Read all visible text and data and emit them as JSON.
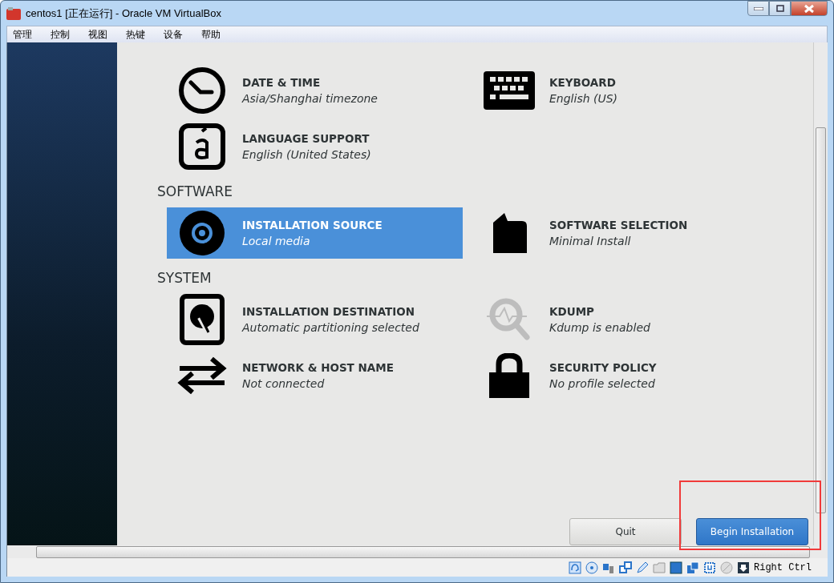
{
  "window": {
    "title": "centos1 [正在运行] - Oracle VM VirtualBox"
  },
  "menu": [
    "管理",
    "控制",
    "视图",
    "热键",
    "设备",
    "帮助"
  ],
  "sections": [
    {
      "items": [
        {
          "kind": "clock",
          "title": "DATE & TIME",
          "status": "Asia/Shanghai timezone",
          "selected": false,
          "disabled": false
        },
        {
          "kind": "keyboard",
          "title": "KEYBOARD",
          "status": "English (US)",
          "selected": false,
          "disabled": false
        },
        {
          "kind": "language",
          "title": "LANGUAGE SUPPORT",
          "status": "English (United States)",
          "selected": false,
          "disabled": false
        }
      ]
    },
    {
      "title": "SOFTWARE",
      "items": [
        {
          "kind": "disc",
          "title": "INSTALLATION SOURCE",
          "status": "Local media",
          "selected": true,
          "disabled": false
        },
        {
          "kind": "package",
          "title": "SOFTWARE SELECTION",
          "status": "Minimal Install",
          "selected": false,
          "disabled": false
        }
      ]
    },
    {
      "title": "SYSTEM",
      "items": [
        {
          "kind": "disk",
          "title": "INSTALLATION DESTINATION",
          "status": "Automatic partitioning selected",
          "selected": false,
          "disabled": false
        },
        {
          "kind": "kdump",
          "title": "KDUMP",
          "status": "Kdump is enabled",
          "selected": false,
          "disabled": true
        },
        {
          "kind": "network",
          "title": "NETWORK & HOST NAME",
          "status": "Not connected",
          "selected": false,
          "disabled": false
        },
        {
          "kind": "lock",
          "title": "SECURITY POLICY",
          "status": "No profile selected",
          "selected": false,
          "disabled": false
        }
      ]
    }
  ],
  "buttons": [
    {
      "label": "Quit",
      "kind": "secondary"
    },
    {
      "label": "Begin Installation",
      "kind": "primary"
    }
  ],
  "status_bar": {
    "host_key": "Right Ctrl"
  }
}
